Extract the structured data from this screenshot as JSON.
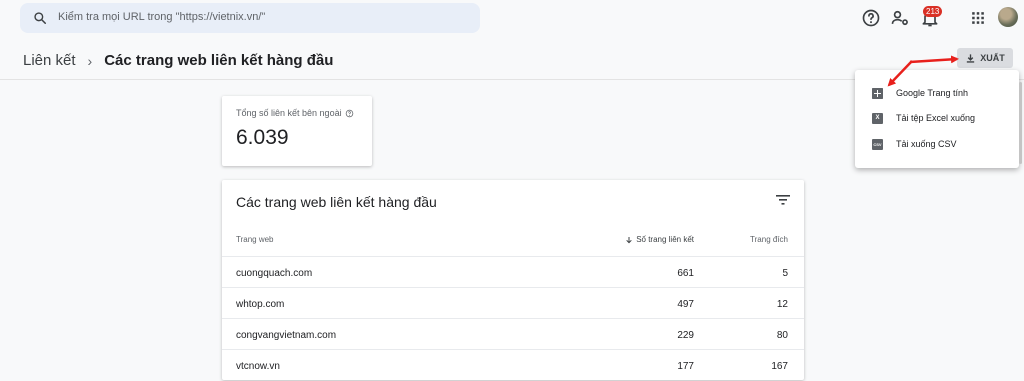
{
  "search": {
    "placeholder": "Kiểm tra mọi URL trong \"https://vietnix.vn/\""
  },
  "topbar": {
    "notification_count": "213"
  },
  "breadcrumb": {
    "parent": "Liên kết",
    "separator": "›",
    "current": "Các trang web liên kết hàng đầu"
  },
  "export": {
    "label": "XUẤT"
  },
  "export_menu": {
    "items": [
      {
        "label": "Google Trang tính",
        "icon": "sheets-icon"
      },
      {
        "label": "Tải tệp Excel xuống",
        "icon_text": "X"
      },
      {
        "label": "Tải xuống CSV",
        "icon_text": "CSV"
      }
    ]
  },
  "summary": {
    "label": "Tổng số liên kết bên ngoài",
    "value": "6.039"
  },
  "table": {
    "title": "Các trang web liên kết hàng đầu",
    "columns": [
      "Trang web",
      "Số trang liên kết",
      "Trang đích"
    ],
    "rows": [
      [
        "cuongquach.com",
        "661",
        "5"
      ],
      [
        "whtop.com",
        "497",
        "12"
      ],
      [
        "congvangvietnam.com",
        "229",
        "80"
      ],
      [
        "vtcnow.vn",
        "177",
        "167"
      ]
    ]
  },
  "colors": {
    "annotation_arrow": "#e8201c",
    "badge": "#d93025",
    "search_bg": "#e8eef8"
  }
}
